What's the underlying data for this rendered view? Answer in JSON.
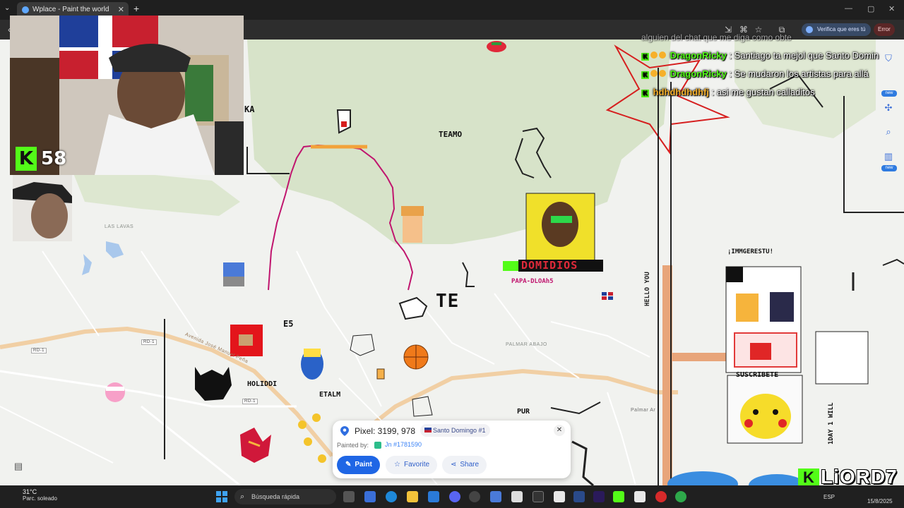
{
  "browser": {
    "tab_title": "Wplace - Paint the world",
    "verifica_label": "Verifica que eres tú",
    "error_label": "Error"
  },
  "stream": {
    "viewer_count": "58",
    "chat": [
      {
        "user": "DragonRicky",
        "message": ": Santiago ta mejol que Santo Domin"
      },
      {
        "user": "DragonRicky",
        "message": ": Se mudaron los artistas para allá"
      },
      {
        "user": "hdhdhdhdhfj",
        "message": ": asi me gustan calladitos"
      }
    ],
    "chat_faded": "alguien del chat que me diga como obte",
    "watermark": "LiORD7"
  },
  "map": {
    "labels": {
      "las_lavas": "LAS LAVAS",
      "palmar_abajo": "PALMAR ABAJO",
      "palmar_arriba": "Palmar Ar",
      "road_rd1_a": "RD-1",
      "road_rd1_b": "RD-1",
      "road_rd1_c": "RD-1",
      "avenida": "Avenida José Manuel Peña"
    },
    "art_text": {
      "teamo": "TEAMO",
      "te": "TE",
      "domidios": "DOMIDIOS",
      "papa": "PAPA-DLOAh5",
      "imm": "¡IMMGERESTU!",
      "hello": "HELLO YOU",
      "suscribete": "SUSCRIBETE",
      "ka": "KA",
      "holidi": "HOLIDDI",
      "etalm": "ETALM",
      "e5": "E5",
      "pur": "PUR",
      "day1": "1DAY 1 WILL"
    }
  },
  "popup": {
    "pixel_label": "Pixel: 3199, 978",
    "region": "Santo Domingo #1",
    "painted_by_label": "Painted by:",
    "painter": "Jn #1781590",
    "paint_button": "Paint",
    "favorite_button": "Favorite",
    "share_button": "Share"
  },
  "taskbar": {
    "temperature": "31°C",
    "weather": "Parc. soleado",
    "search_placeholder": "Búsqueda rápida",
    "language": "ESP",
    "date": "15/8/2025"
  },
  "colors": {
    "kick_green": "#53fc18",
    "paint_blue": "#1f66e5",
    "chat_user_green": "#53fc18",
    "chat_user_orange": "#f6b02a"
  }
}
